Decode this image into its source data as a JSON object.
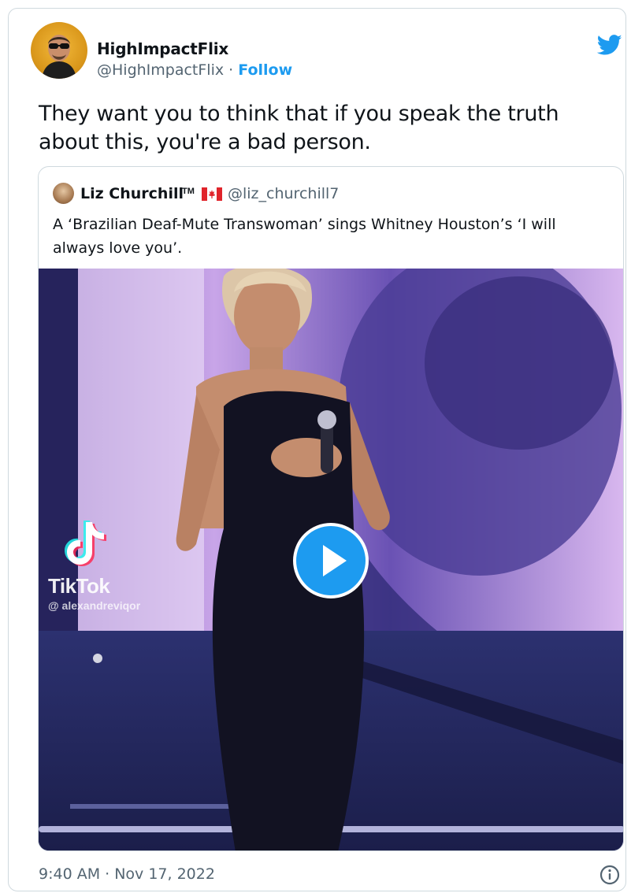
{
  "author": {
    "name": "HighImpactFlix",
    "handle": "@HighImpactFlix",
    "separator": " · ",
    "follow_label": "Follow"
  },
  "tweet": {
    "text": "They want you to think that if you speak the truth about this, you're a bad person.",
    "timestamp": "9:40 AM · Nov 17, 2022"
  },
  "quoted": {
    "name": "Liz Churchill",
    "trademark": "TM",
    "flag": "canada-flag",
    "handle": "@liz_churchill7",
    "text": "A ‘Brazilian Deaf-Mute Transwoman’ sings Whitney Houston’s ‘I will always love you’.",
    "video": {
      "watermark_brand": "TikTok",
      "watermark_user": "@ alexandreviqor",
      "play_icon": "play-icon"
    }
  },
  "icons": {
    "brand": "twitter-bird-icon",
    "info": "info-icon"
  },
  "colors": {
    "accent": "#1d9bf0",
    "text": "#0f1419",
    "muted": "#536471",
    "border": "#cfd9de"
  }
}
